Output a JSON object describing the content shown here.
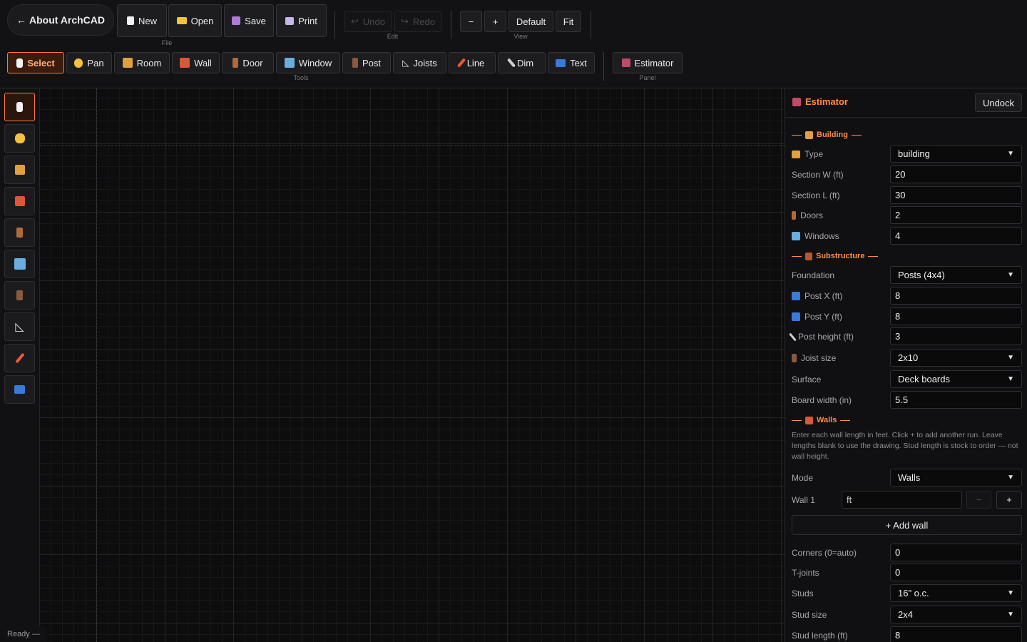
{
  "app": {
    "about_label": "About ArchCAD"
  },
  "file": {
    "label": "File",
    "new": "New",
    "open": "Open",
    "save": "Save",
    "print": "Print"
  },
  "edit": {
    "label": "Edit",
    "undo": "Undo",
    "redo": "Redo"
  },
  "view": {
    "label": "View",
    "zoom_out": "−",
    "zoom_in": "+",
    "default": "Default",
    "fit": "Fit"
  },
  "tools": {
    "label": "Tools",
    "items": [
      "Select",
      "Pan",
      "Room",
      "Wall",
      "Door",
      "Window",
      "Post",
      "Joists",
      "Line",
      "Dim",
      "Text"
    ]
  },
  "panel_group": {
    "label": "Panel",
    "estimator": "Estimator"
  },
  "status": {
    "text": "Ready —"
  },
  "estimator": {
    "title": "Estimator",
    "undock": "Undock",
    "building": {
      "heading": "Building",
      "type_label": "Type",
      "type_value": "building",
      "section_w_label": "Section W (ft)",
      "section_w_value": "20",
      "section_l_label": "Section L (ft)",
      "section_l_value": "30",
      "doors_label": "Doors",
      "doors_value": "2",
      "windows_label": "Windows",
      "windows_value": "4"
    },
    "substructure": {
      "heading": "Substructure",
      "foundation_label": "Foundation",
      "foundation_value": "Posts (4x4)",
      "post_x_label": "Post X (ft)",
      "post_x_value": "8",
      "post_y_label": "Post Y (ft)",
      "post_y_value": "8",
      "post_height_label": "Post height (ft)",
      "post_height_value": "3",
      "joist_size_label": "Joist size",
      "joist_size_value": "2x10",
      "surface_label": "Surface",
      "surface_value": "Deck boards",
      "board_width_label": "Board width (in)",
      "board_width_value": "5.5"
    },
    "walls": {
      "heading": "Walls",
      "note": "Enter each wall length in feet. Click + to add another run. Leave lengths blank to use the drawing. Stud length is stock to order — not wall height.",
      "mode_label": "Mode",
      "mode_value": "Walls",
      "wall1_label": "Wall 1",
      "wall1_placeholder": "ft",
      "minus": "−",
      "plus": "+",
      "add_wall": "+ Add wall",
      "corners_label": "Corners (0=auto)",
      "corners_value": "0",
      "tjoints_label": "T-joints",
      "tjoints_value": "0",
      "studs_label": "Studs",
      "studs_value": "16\" o.c.",
      "stud_size_label": "Stud size",
      "stud_size_value": "2x4",
      "stud_length_label": "Stud length (ft)",
      "stud_length_value": "8"
    }
  }
}
